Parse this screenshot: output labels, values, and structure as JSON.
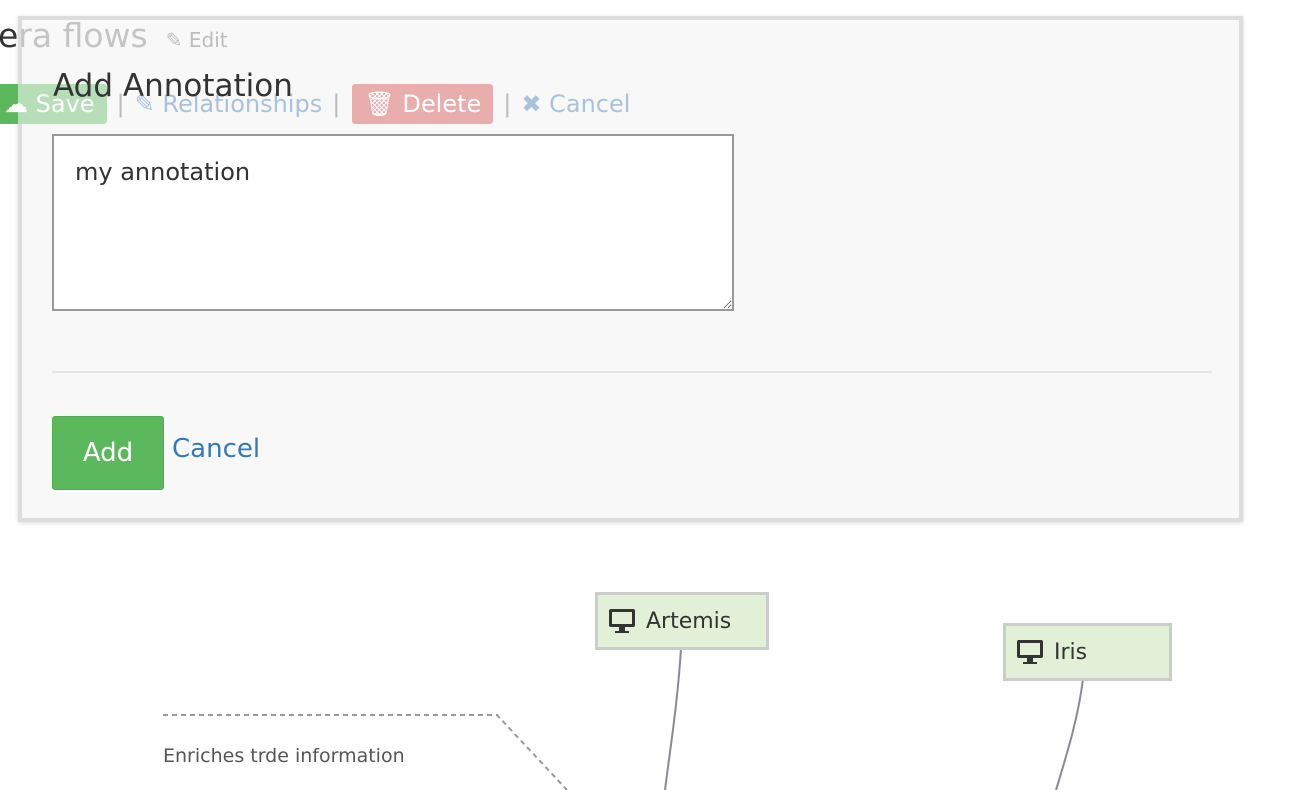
{
  "background": {
    "title": "era flows",
    "edit_label": "✎ Edit",
    "toolbar": {
      "save": "☁ Save",
      "relationships": "✎ Relationships",
      "delete": "🗑 Delete",
      "cancel": "✖ Cancel",
      "separator": "|"
    }
  },
  "dialog": {
    "title": "Add Annotation",
    "textarea_value": "my annotation",
    "add_label": "Add",
    "cancel_label": "Cancel"
  },
  "diagram": {
    "nodes": [
      {
        "label": "Artemis",
        "icon": "desktop-icon"
      },
      {
        "label": "Iris",
        "icon": "desktop-icon"
      }
    ],
    "edge_label": "Enriches trde information"
  }
}
